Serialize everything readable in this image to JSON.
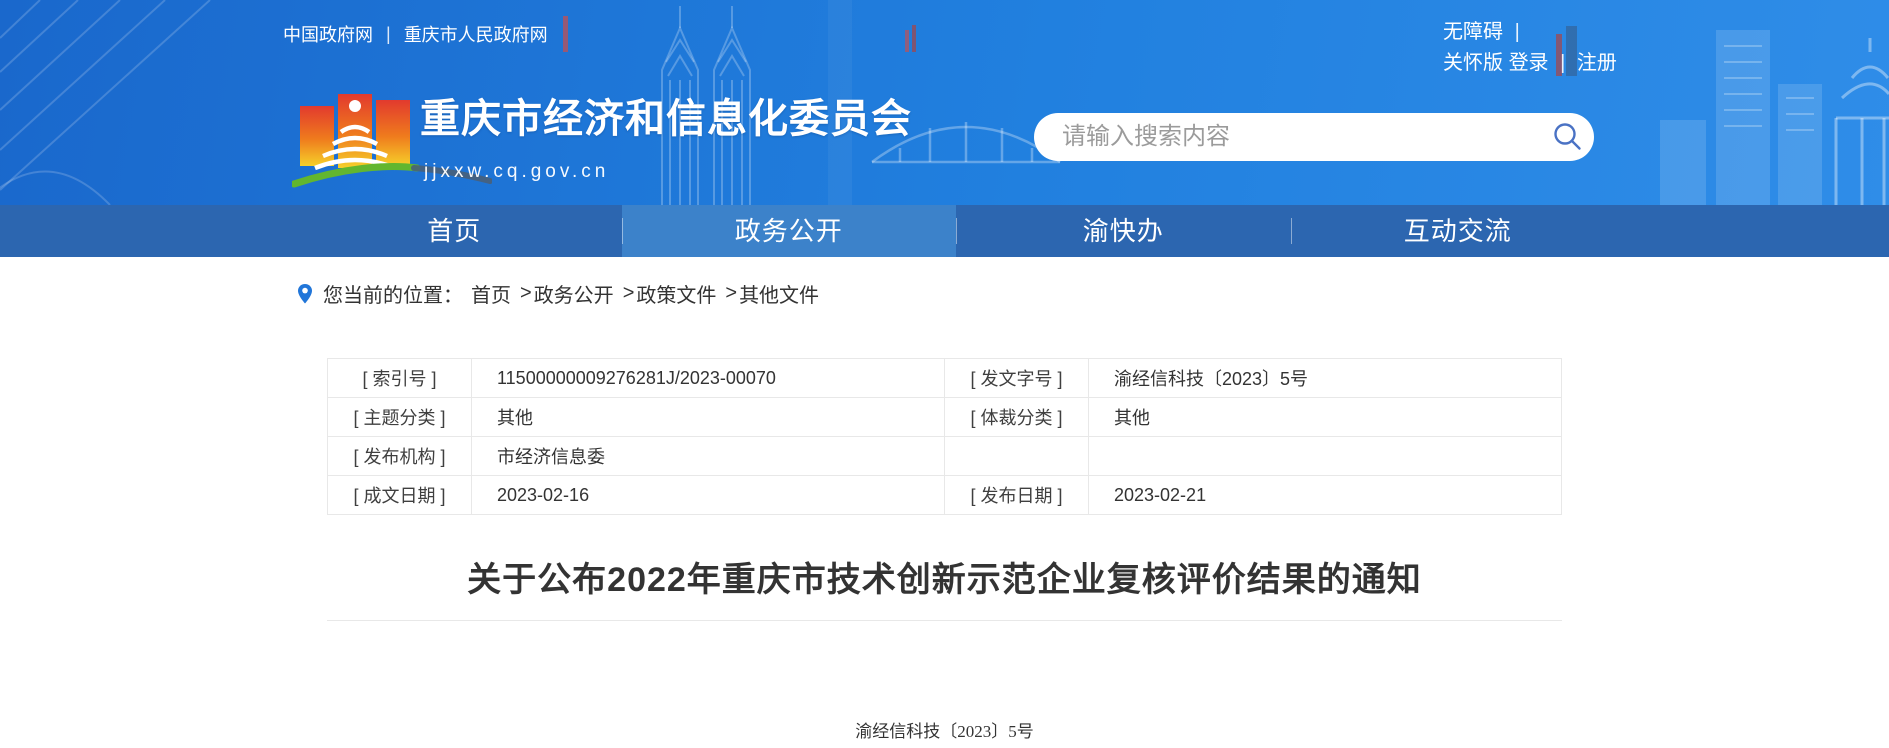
{
  "topbar": {
    "left_links": [
      {
        "label": "中国政府网"
      },
      {
        "label": "重庆市人民政府网"
      }
    ],
    "separator": "|",
    "accessibility": "无障碍",
    "care_version": "关怀版",
    "login": "登录",
    "register": "注册"
  },
  "brand": {
    "title": "重庆市经济和信息化委员会",
    "url": "jjxxw.cq.gov.cn"
  },
  "search": {
    "placeholder": "请输入搜索内容"
  },
  "nav": {
    "items": [
      {
        "label": "首页"
      },
      {
        "label": "政务公开"
      },
      {
        "label": "渝快办"
      },
      {
        "label": "互动交流"
      }
    ],
    "active_index": 1
  },
  "breadcrumb": {
    "prefix": "您当前的位置：",
    "separator": ">",
    "items": [
      {
        "label": "首页"
      },
      {
        "label": "政务公开"
      },
      {
        "label": "政策文件"
      },
      {
        "label": "其他文件"
      }
    ]
  },
  "meta_table": {
    "rows": [
      {
        "label1": "[ 索引号 ]",
        "value1": "11500000009276281J/2023-00070",
        "label2": "[ 发文字号 ]",
        "value2": "渝经信科技〔2023〕5号"
      },
      {
        "label1": "[ 主题分类 ]",
        "value1": "其他",
        "label2": "[ 体裁分类 ]",
        "value2": "其他"
      },
      {
        "label1": "[ 发布机构 ]",
        "value1": "市经济信息委",
        "label2": "",
        "value2": ""
      },
      {
        "label1": "[ 成文日期 ]",
        "value1": "2023-02-16",
        "label2": "[ 发布日期 ]",
        "value2": "2023-02-21"
      }
    ]
  },
  "document": {
    "title": "关于公布2022年重庆市技术创新示范企业复核评价结果的通知",
    "doc_number": "渝经信科技〔2023〕5号"
  },
  "colors": {
    "header_gradient_start": "#1a68cc",
    "header_gradient_end": "#2f8de8",
    "nav_bg": "#2c66b0",
    "nav_active_bg": "#3c82ca",
    "accent_blue": "#2176d9"
  }
}
